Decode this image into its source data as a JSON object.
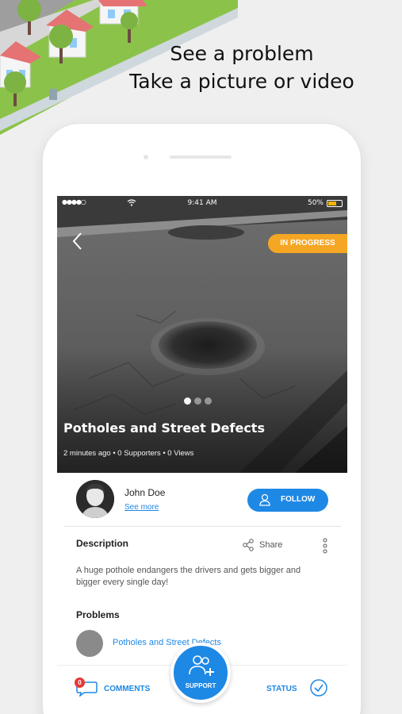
{
  "promo": {
    "headline_line1": "See a problem",
    "headline_line2": "Take a picture or video"
  },
  "status_bar": {
    "signal": "●●●●○",
    "time": "9:41 AM",
    "battery": "50%"
  },
  "issue": {
    "status_badge": "IN PROGRESS",
    "title": "Potholes and Street Defects",
    "meta": "2 minutes ago  •  0 Supporters  •  0 Views",
    "photo_count": 3,
    "active_photo": 1
  },
  "user": {
    "name": "John Doe",
    "see_more": "See more",
    "follow_label": "FOLLOW"
  },
  "description": {
    "title": "Description",
    "share_label": "Share",
    "text": "A huge pothole endangers the drivers and gets bigger and bigger every single day!"
  },
  "problems": {
    "title": "Problems",
    "items": [
      {
        "label": "Potholes and Street Defects"
      }
    ]
  },
  "bottom_bar": {
    "comments_label": "COMMENTS",
    "comments_count": "0",
    "support_label": "SUPPORT",
    "status_label": "STATUS"
  },
  "colors": {
    "accent": "#1e88e5",
    "badge": "#f5a623",
    "notification": "#e53935",
    "background": "#efefef"
  }
}
